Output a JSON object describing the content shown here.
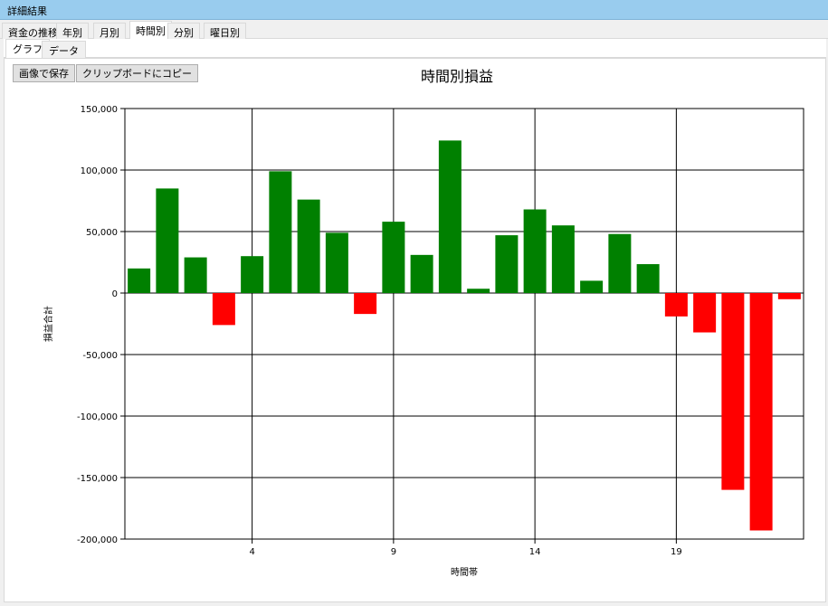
{
  "window": {
    "title": "詳細結果"
  },
  "tabs": [
    {
      "label": "資金の推移"
    },
    {
      "label": "年別"
    },
    {
      "label": "月別"
    },
    {
      "label": "時間別"
    },
    {
      "label": "分別"
    },
    {
      "label": "曜日別"
    }
  ],
  "subtabs": [
    {
      "label": "グラフ"
    },
    {
      "label": "データ"
    }
  ],
  "toolbar": {
    "save_image_label": "画像で保存",
    "copy_clipboard_label": "クリップボードにコピー"
  },
  "colors": {
    "positive": "#008000",
    "negative": "#ff0000",
    "grid": "#000000"
  },
  "chart_data": {
    "type": "bar",
    "title": "時間別損益",
    "xlabel": "時間帯",
    "ylabel": "損益合計",
    "x": [
      0,
      1,
      2,
      3,
      4,
      5,
      6,
      7,
      8,
      9,
      10,
      11,
      12,
      13,
      14,
      15,
      16,
      17,
      18,
      19,
      20,
      21,
      22,
      23
    ],
    "values": [
      20000,
      85000,
      29000,
      -26000,
      30000,
      99000,
      76000,
      49000,
      -17000,
      58000,
      31000,
      124000,
      3500,
      47000,
      68000,
      55000,
      10000,
      48000,
      23500,
      -19000,
      -32000,
      -160000,
      -193000,
      -5000
    ],
    "ylim": [
      -200000,
      150000
    ],
    "yticks": [
      150000,
      100000,
      50000,
      0,
      -50000,
      -100000,
      -150000,
      -200000
    ],
    "ytick_labels": [
      "150,000",
      "100,000",
      "50,000",
      "0",
      "-50,000",
      "-100,000",
      "-150,000",
      "-200,000"
    ],
    "xticks": [
      4,
      9,
      14,
      19
    ],
    "xtick_labels": [
      "4",
      "9",
      "14",
      "19"
    ],
    "grid": true
  }
}
